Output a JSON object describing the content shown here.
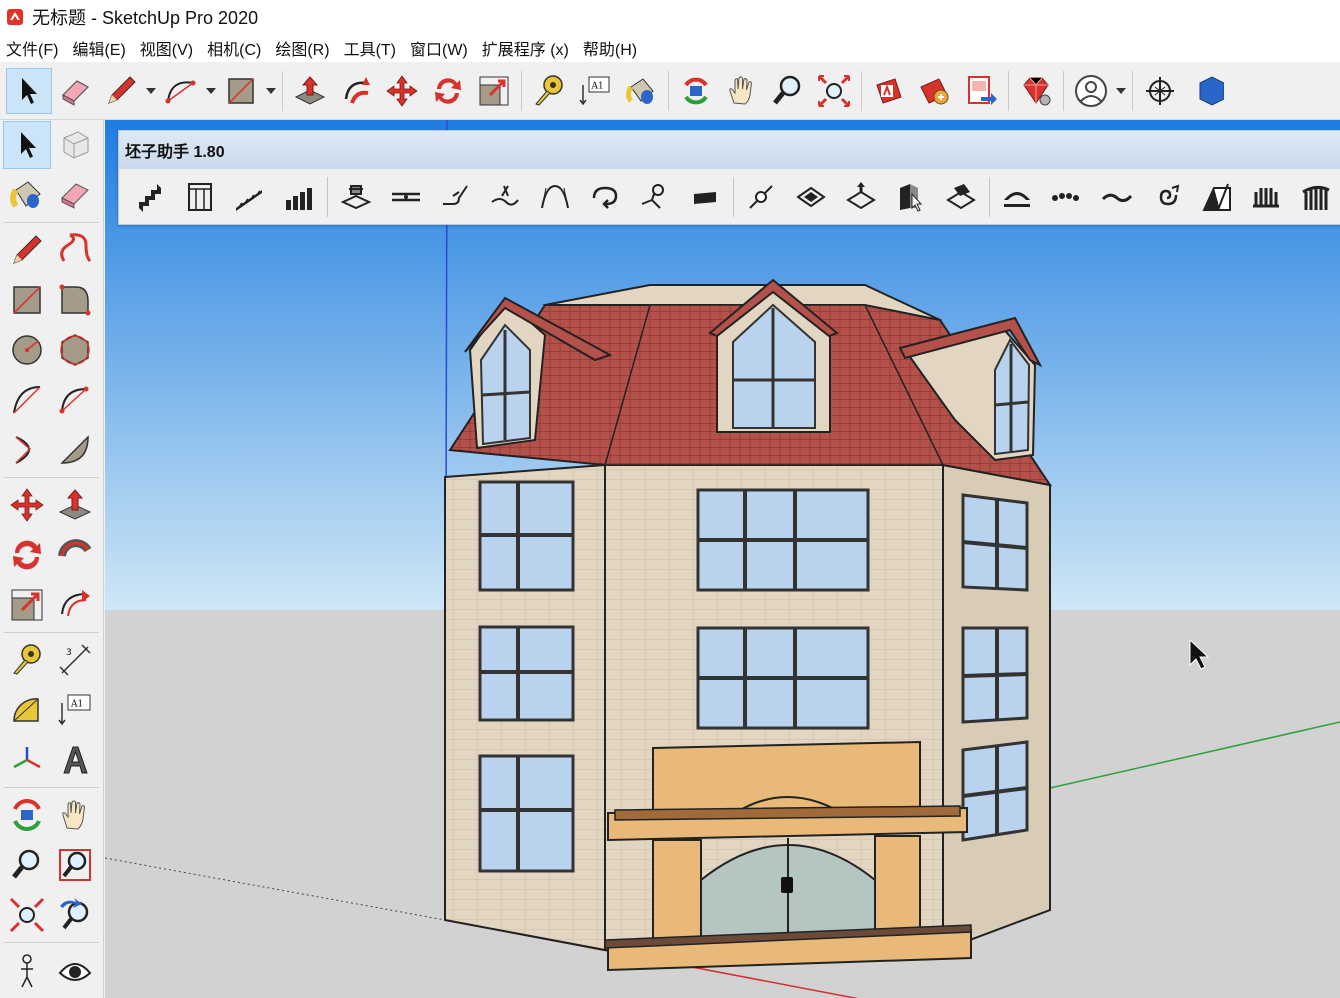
{
  "window": {
    "title": "无标题 - SketchUp Pro 2020",
    "app_icon": "sketchup-logo-icon"
  },
  "menu": {
    "items": [
      "文件(F)",
      "编辑(E)",
      "视图(V)",
      "相机(C)",
      "绘图(R)",
      "工具(T)",
      "窗口(W)",
      "扩展程序 (x)",
      "帮助(H)"
    ]
  },
  "main_toolbar": {
    "tools": [
      {
        "name": "select-icon",
        "active": true
      },
      {
        "name": "eraser-icon"
      },
      {
        "name": "pencil-line-icon",
        "dropdown": true
      },
      {
        "name": "arc-icon",
        "dropdown": true
      },
      {
        "name": "rectangle-icon",
        "dropdown": true
      },
      {
        "name": "push-pull-icon"
      },
      {
        "name": "follow-me-icon"
      },
      {
        "name": "move-icon"
      },
      {
        "name": "rotate-icon"
      },
      {
        "name": "scale-icon"
      },
      {
        "name": "tape-measure-icon"
      },
      {
        "name": "text-label-icon"
      },
      {
        "name": "paint-bucket-icon"
      },
      {
        "name": "orbit-icon"
      },
      {
        "name": "pan-icon"
      },
      {
        "name": "zoom-icon"
      },
      {
        "name": "zoom-extents-icon"
      },
      {
        "name": "warehouse-icon"
      },
      {
        "name": "extension-warehouse-icon"
      },
      {
        "name": "layout-send-icon"
      },
      {
        "name": "ruby-extension-icon"
      },
      {
        "name": "user-account-icon",
        "dropdown": true
      },
      {
        "name": "axes-position-icon"
      },
      {
        "name": "cube-icon"
      }
    ],
    "text_tool_label": "A1"
  },
  "floating_toolbar": {
    "title": "坯子助手 1.80",
    "tools": [
      "stair-icon",
      "wall-grid-icon",
      "ramp-icon",
      "bars-icon",
      "weld-icon",
      "line-split-icon",
      "fillet-icon",
      "trim-icon",
      "bezier-icon",
      "curve-loop-icon",
      "joint-icon",
      "flat-panel-icon",
      "drill-icon",
      "diamond-face-icon",
      "stack-face-icon",
      "cube-select-icon",
      "fill-face-icon",
      "dome-icon",
      "dots-path-icon",
      "wave-line-icon",
      "spiral-icon",
      "slope-icon",
      "comb-icon",
      "rail-icon"
    ]
  },
  "left_toolbar": {
    "rows": [
      [
        "select-icon",
        "component-icon"
      ],
      [
        "paint-bucket-icon",
        "eraser-icon"
      ],
      [
        "pencil-line-icon",
        "freehand-icon"
      ],
      [
        "rectangle-icon",
        "rotated-rect-icon"
      ],
      [
        "circle-icon",
        "polygon-icon"
      ],
      [
        "arc-icon",
        "two-point-arc-icon"
      ],
      [
        "three-point-arc-icon",
        "pie-icon"
      ],
      [
        "move-icon",
        "push-pull-icon"
      ],
      [
        "rotate-icon",
        "follow-me-icon"
      ],
      [
        "scale-icon",
        "offset-icon"
      ],
      [
        "tape-measure-icon",
        "dimension-icon"
      ],
      [
        "protractor-icon",
        "text-label-icon"
      ],
      [
        "axes-icon",
        "3d-text-icon"
      ],
      [
        "orbit-icon",
        "pan-icon"
      ],
      [
        "zoom-icon",
        "zoom-window-icon"
      ],
      [
        "zoom-extents-icon",
        "previous-view-icon"
      ],
      [
        "walk-icon",
        "look-around-icon"
      ]
    ],
    "active": "select-icon"
  },
  "viewport": {
    "sky_top": "#1f7de0",
    "sky_bottom": "#cfe7f6",
    "ground": "#d2d2d2",
    "roof_color": "#b4514a",
    "wall_color": "#e2d6c2",
    "glass_color": "#b9d3ef",
    "entrance_color": "#e8b978",
    "axis_red": "#d23030",
    "axis_green": "#2ea03a",
    "axis_blue": "#2b48d6"
  }
}
